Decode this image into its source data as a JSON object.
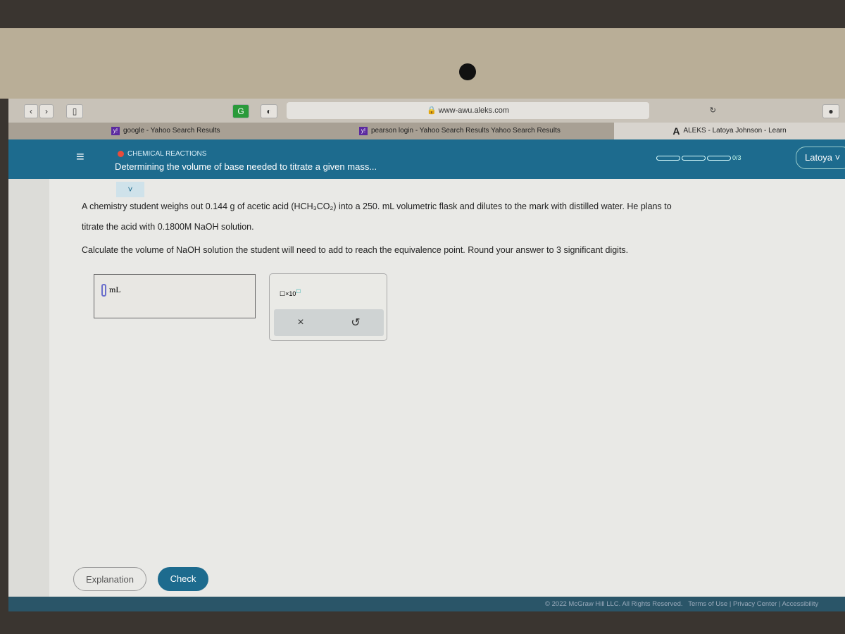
{
  "browser": {
    "url": "www-awu.aleks.com",
    "tabs": [
      {
        "label": "google - Yahoo Search Results"
      },
      {
        "label": "pearson login - Yahoo Search Results Yahoo Search Results"
      },
      {
        "label": "ALEKS - Latoya Johnson - Learn"
      }
    ]
  },
  "header": {
    "category": "CHEMICAL REACTIONS",
    "title": "Determining the volume of base needed to titrate a given mass...",
    "progress": "0/3",
    "progress_fraction": 0,
    "user": "Latoya"
  },
  "question": {
    "line1": "A chemistry student weighs out 0.144 g of acetic acid (HCH₃CO₂) into a 250. mL volumetric flask and dilutes to the mark with distilled water. He plans to",
    "line2": "titrate the acid with 0.1800M NaOH solution.",
    "line3": "Calculate the volume of NaOH solution the student will need to add to reach the equivalence point. Round your answer to 3 significant digits."
  },
  "answer": {
    "value": "",
    "unit": "mL"
  },
  "pad": {
    "sci": "×10",
    "clear": "×",
    "undo": "↺"
  },
  "buttons": {
    "explanation": "Explanation",
    "check": "Check"
  },
  "footer": {
    "copyright": "© 2022 McGraw Hill LLC. All Rights Reserved.",
    "terms": "Terms of Use",
    "privacy": "Privacy Center",
    "access": "Accessibility"
  }
}
